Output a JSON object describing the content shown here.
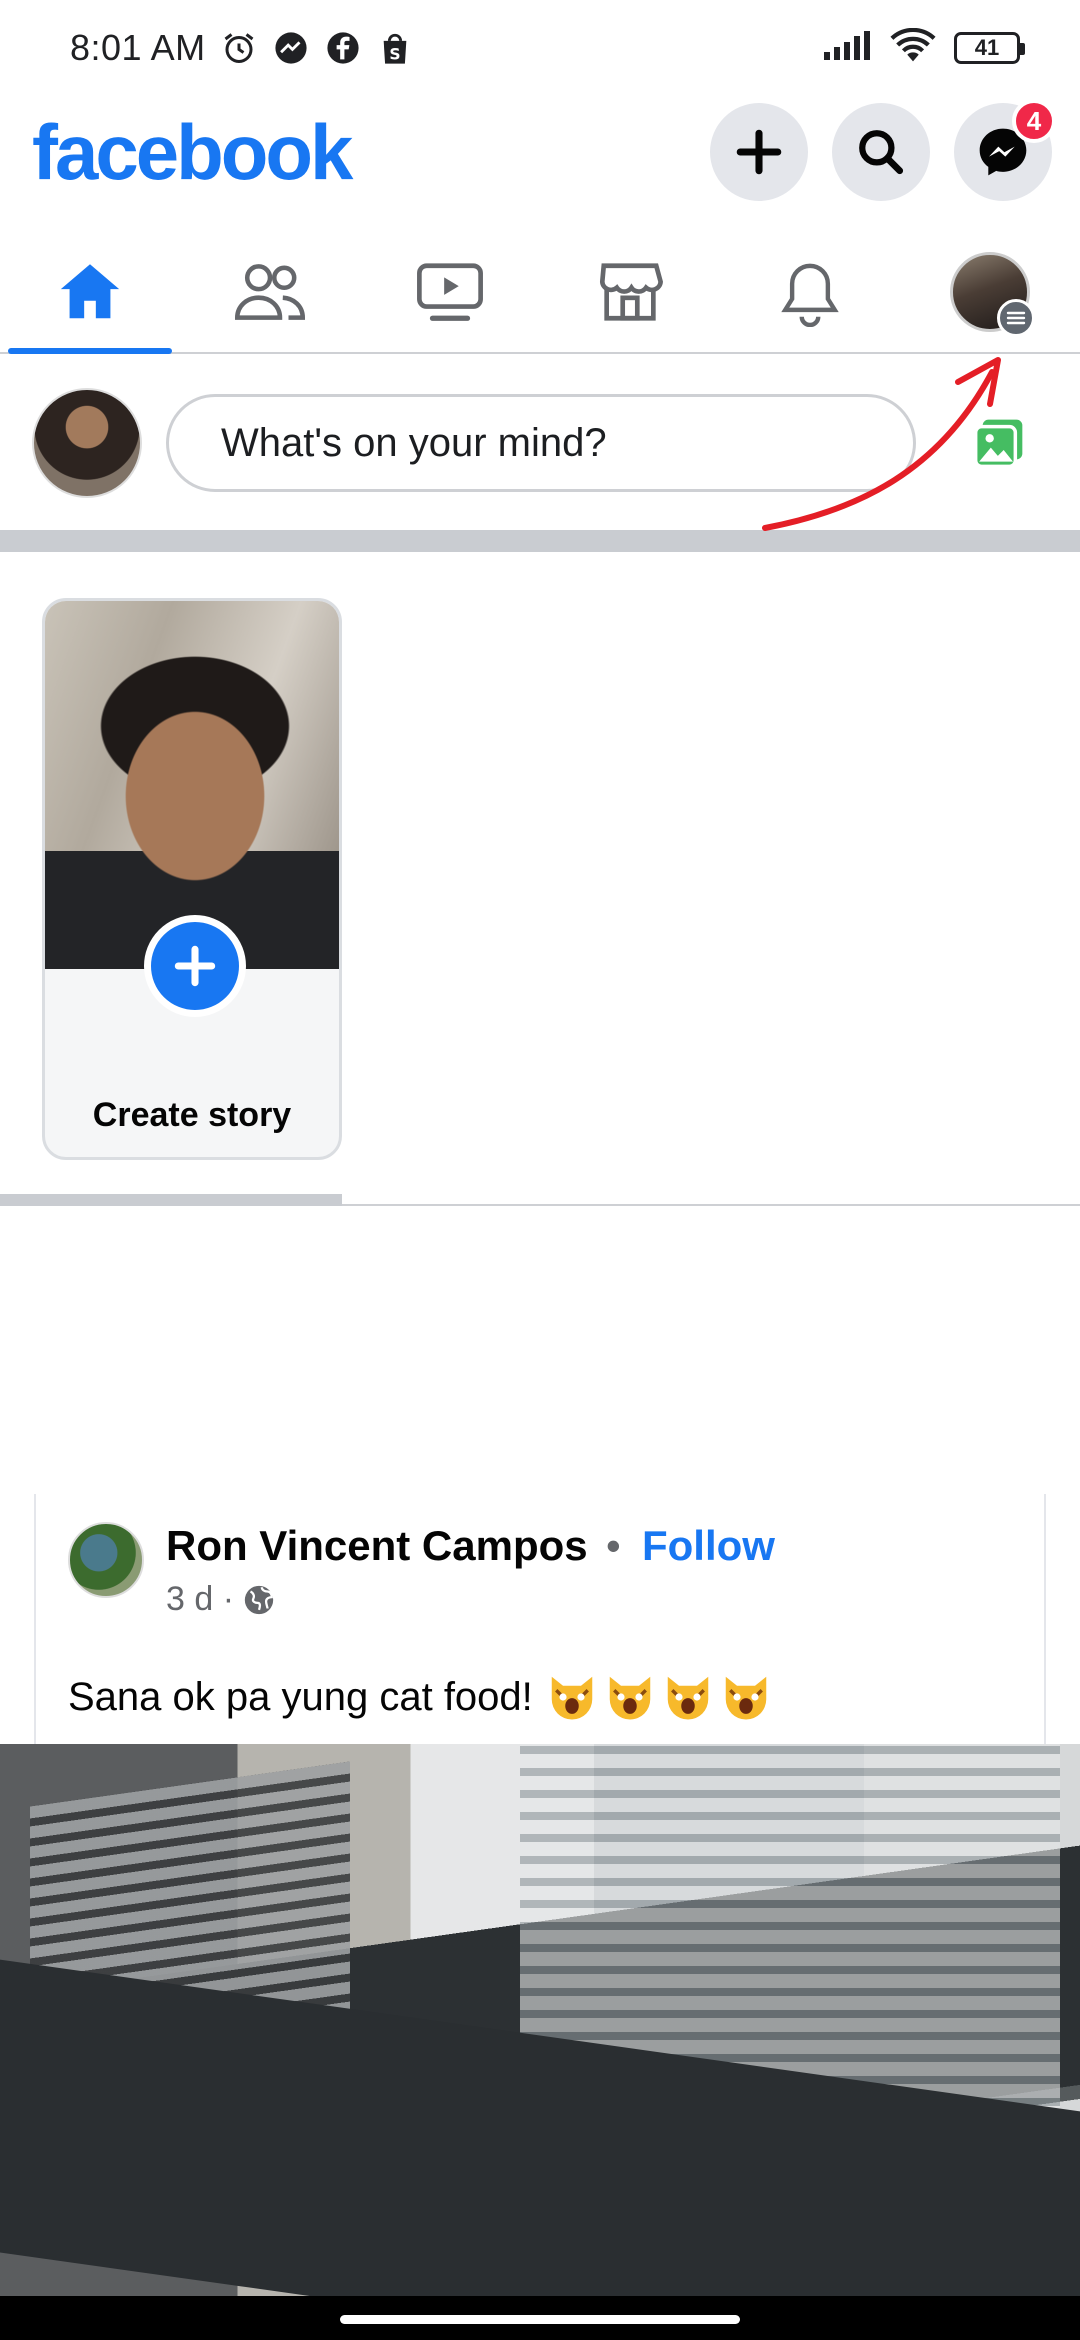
{
  "status_bar": {
    "time": "8:01 AM",
    "battery": "41",
    "left_icons": [
      "alarm-icon",
      "messenger-icon",
      "facebook-icon",
      "shopee-icon"
    ],
    "right_icons": [
      "signal-icon",
      "wifi-icon",
      "battery-icon"
    ]
  },
  "header": {
    "logo": "facebook",
    "messenger_badge": "4",
    "actions": [
      "create-icon",
      "search-icon",
      "messenger-icon"
    ]
  },
  "tabs": [
    {
      "name": "home",
      "active": true
    },
    {
      "name": "friends",
      "active": false
    },
    {
      "name": "watch",
      "active": false
    },
    {
      "name": "marketplace",
      "active": false
    },
    {
      "name": "notifications",
      "active": false
    },
    {
      "name": "menu-profile",
      "active": false
    }
  ],
  "composer": {
    "placeholder": "What's on your mind?"
  },
  "stories": {
    "create_label": "Create story"
  },
  "post": {
    "author": "Ron Vincent Campos",
    "separator": "•",
    "follow_label": "Follow",
    "time": "3 d ·",
    "text": "Sana ok pa yung cat food!"
  },
  "colors": {
    "brand": "#1877f2",
    "badge": "#f02849",
    "annotation_arrow": "#e41e26"
  }
}
